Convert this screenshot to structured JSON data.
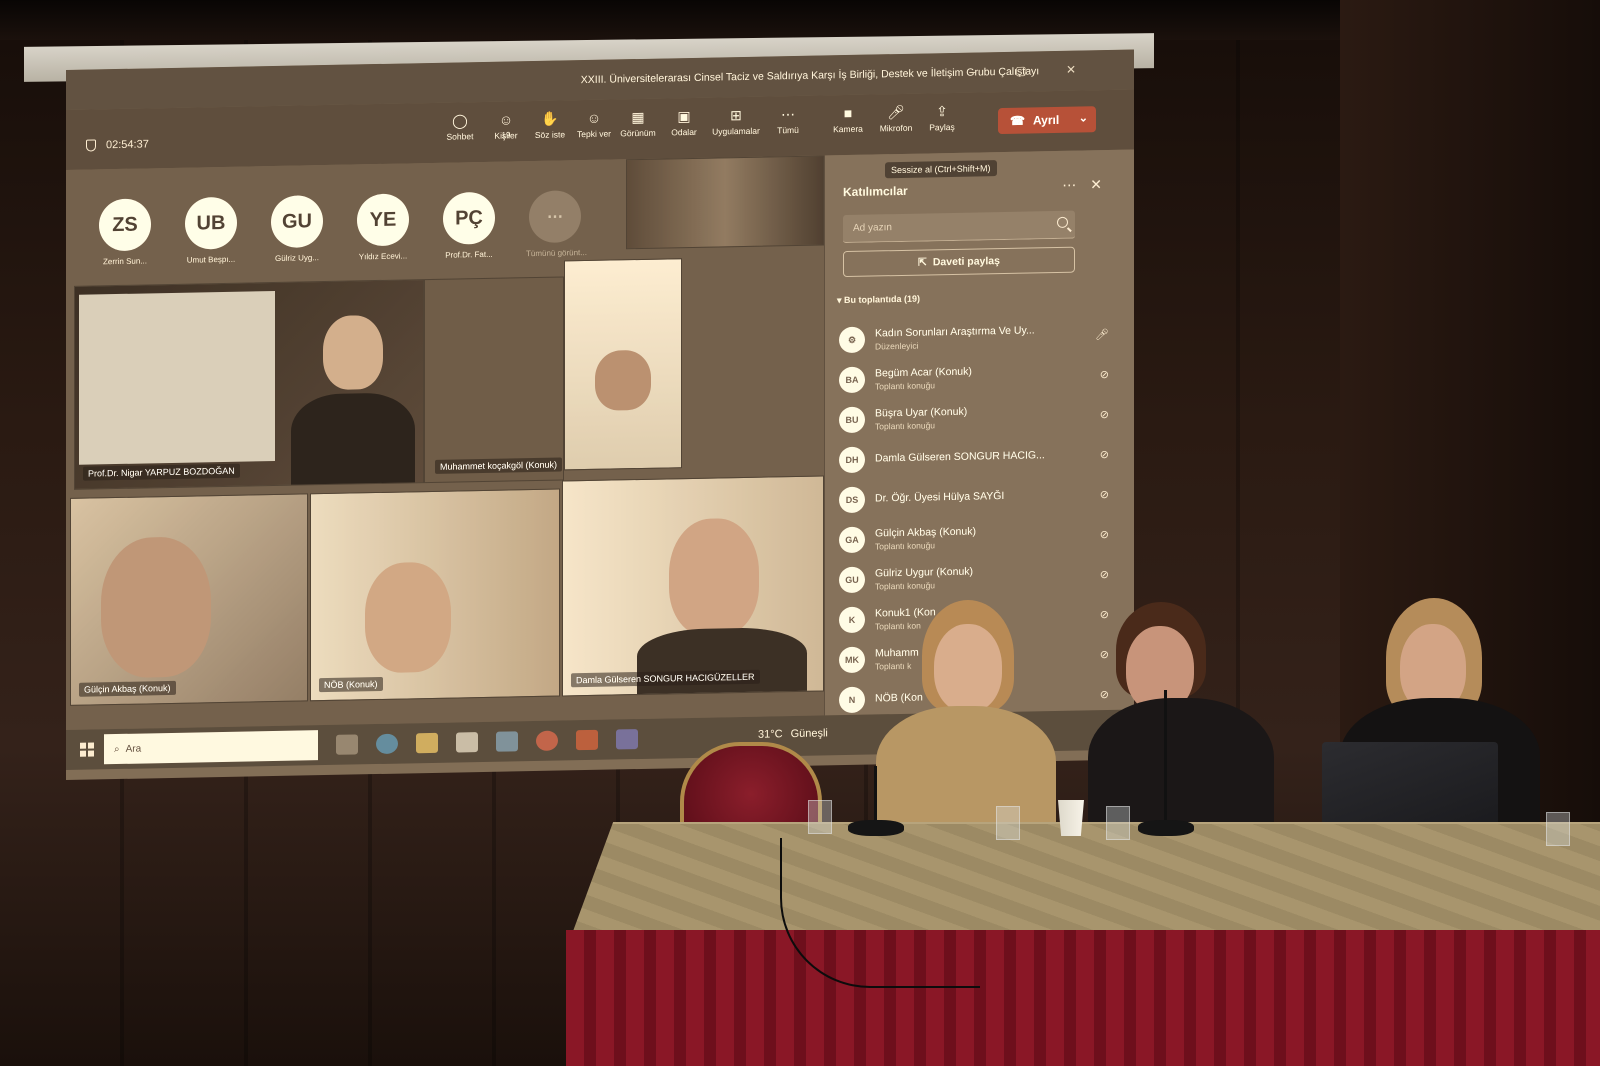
{
  "meeting": {
    "title": "XXIII. Üniversitelerarası Cinsel Taciz ve Saldırıya Karşı İş Birliği, Destek ve İletişim Grubu Çalıştayı",
    "timer": "02:54:37"
  },
  "toolbar": {
    "people_count": "19",
    "buttons": [
      {
        "label": "Sohbet",
        "icon": "chat-icon"
      },
      {
        "label": "Kişiler",
        "icon": "people-icon"
      },
      {
        "label": "Söz iste",
        "icon": "raise-hand-icon"
      },
      {
        "label": "Tepki ver",
        "icon": "reaction-icon"
      },
      {
        "label": "Görünüm",
        "icon": "view-icon"
      },
      {
        "label": "Odalar",
        "icon": "rooms-icon"
      },
      {
        "label": "Uygulamalar",
        "icon": "apps-icon"
      },
      {
        "label": "Tümü",
        "icon": "more-icon"
      },
      {
        "label": "Kamera",
        "icon": "camera-icon"
      },
      {
        "label": "Mikrofon",
        "icon": "mic-icon"
      },
      {
        "label": "Paylaş",
        "icon": "share-screen-icon"
      }
    ],
    "leave_label": "Ayrıl",
    "mic_tooltip": "Sessize al (Ctrl+Shift+M)"
  },
  "avatars": [
    {
      "initials": "ZS",
      "name": "Zerrin Sun..."
    },
    {
      "initials": "UB",
      "name": "Umut Beşpı..."
    },
    {
      "initials": "GU",
      "name": "Gülriz Uyg..."
    },
    {
      "initials": "YE",
      "name": "Yıldız Ecevi..."
    },
    {
      "initials": "PÇ",
      "name": "Prof.Dr. Fat..."
    }
  ],
  "more_avatars_label": "Tümünü görünt...",
  "tiles": {
    "nigar": "Prof.Dr. Nigar YARPUZ BOZDOĞAN",
    "muhammet": "Muhammet koçakgöl (Konuk)",
    "gulcin": "Gülçin Akbaş (Konuk)",
    "nob": "NÖB (Konuk)",
    "damla": "Damla Gülseren SONGUR HACIGÜZELLER"
  },
  "panel": {
    "title": "Katılımcılar",
    "search_placeholder": "Ad yazın",
    "share_invite_label": "Daveti paylaş",
    "section_label": "Bu toplantıda (19)",
    "participants": [
      {
        "initials": "",
        "name": "Kadın Sorunları Araştırma Ve Uy...",
        "role": "Düzenleyici"
      },
      {
        "initials": "BA",
        "name": "Begüm Acar (Konuk)",
        "role": "Toplantı konuğu"
      },
      {
        "initials": "BU",
        "name": "Büşra Uyar (Konuk)",
        "role": "Toplantı konuğu"
      },
      {
        "initials": "DH",
        "name": "Damla Gülseren SONGUR HACIG...",
        "role": ""
      },
      {
        "initials": "DS",
        "name": "Dr. Öğr. Üyesi Hülya SAYĞI",
        "role": ""
      },
      {
        "initials": "GA",
        "name": "Gülçin Akbaş (Konuk)",
        "role": "Toplantı konuğu"
      },
      {
        "initials": "GU",
        "name": "Gülriz Uygur (Konuk)",
        "role": "Toplantı konuğu"
      },
      {
        "initials": "K",
        "name": "Konuk1 (Kon",
        "role": "Toplantı kon"
      },
      {
        "initials": "MK",
        "name": "Muhamm",
        "role": "Toplantı k"
      },
      {
        "initials": "N",
        "name": "NÖB (Kon",
        "role": ""
      }
    ]
  },
  "taskbar": {
    "search_placeholder": "Ara",
    "weather": "31°C",
    "weather_label": "Güneşli"
  }
}
